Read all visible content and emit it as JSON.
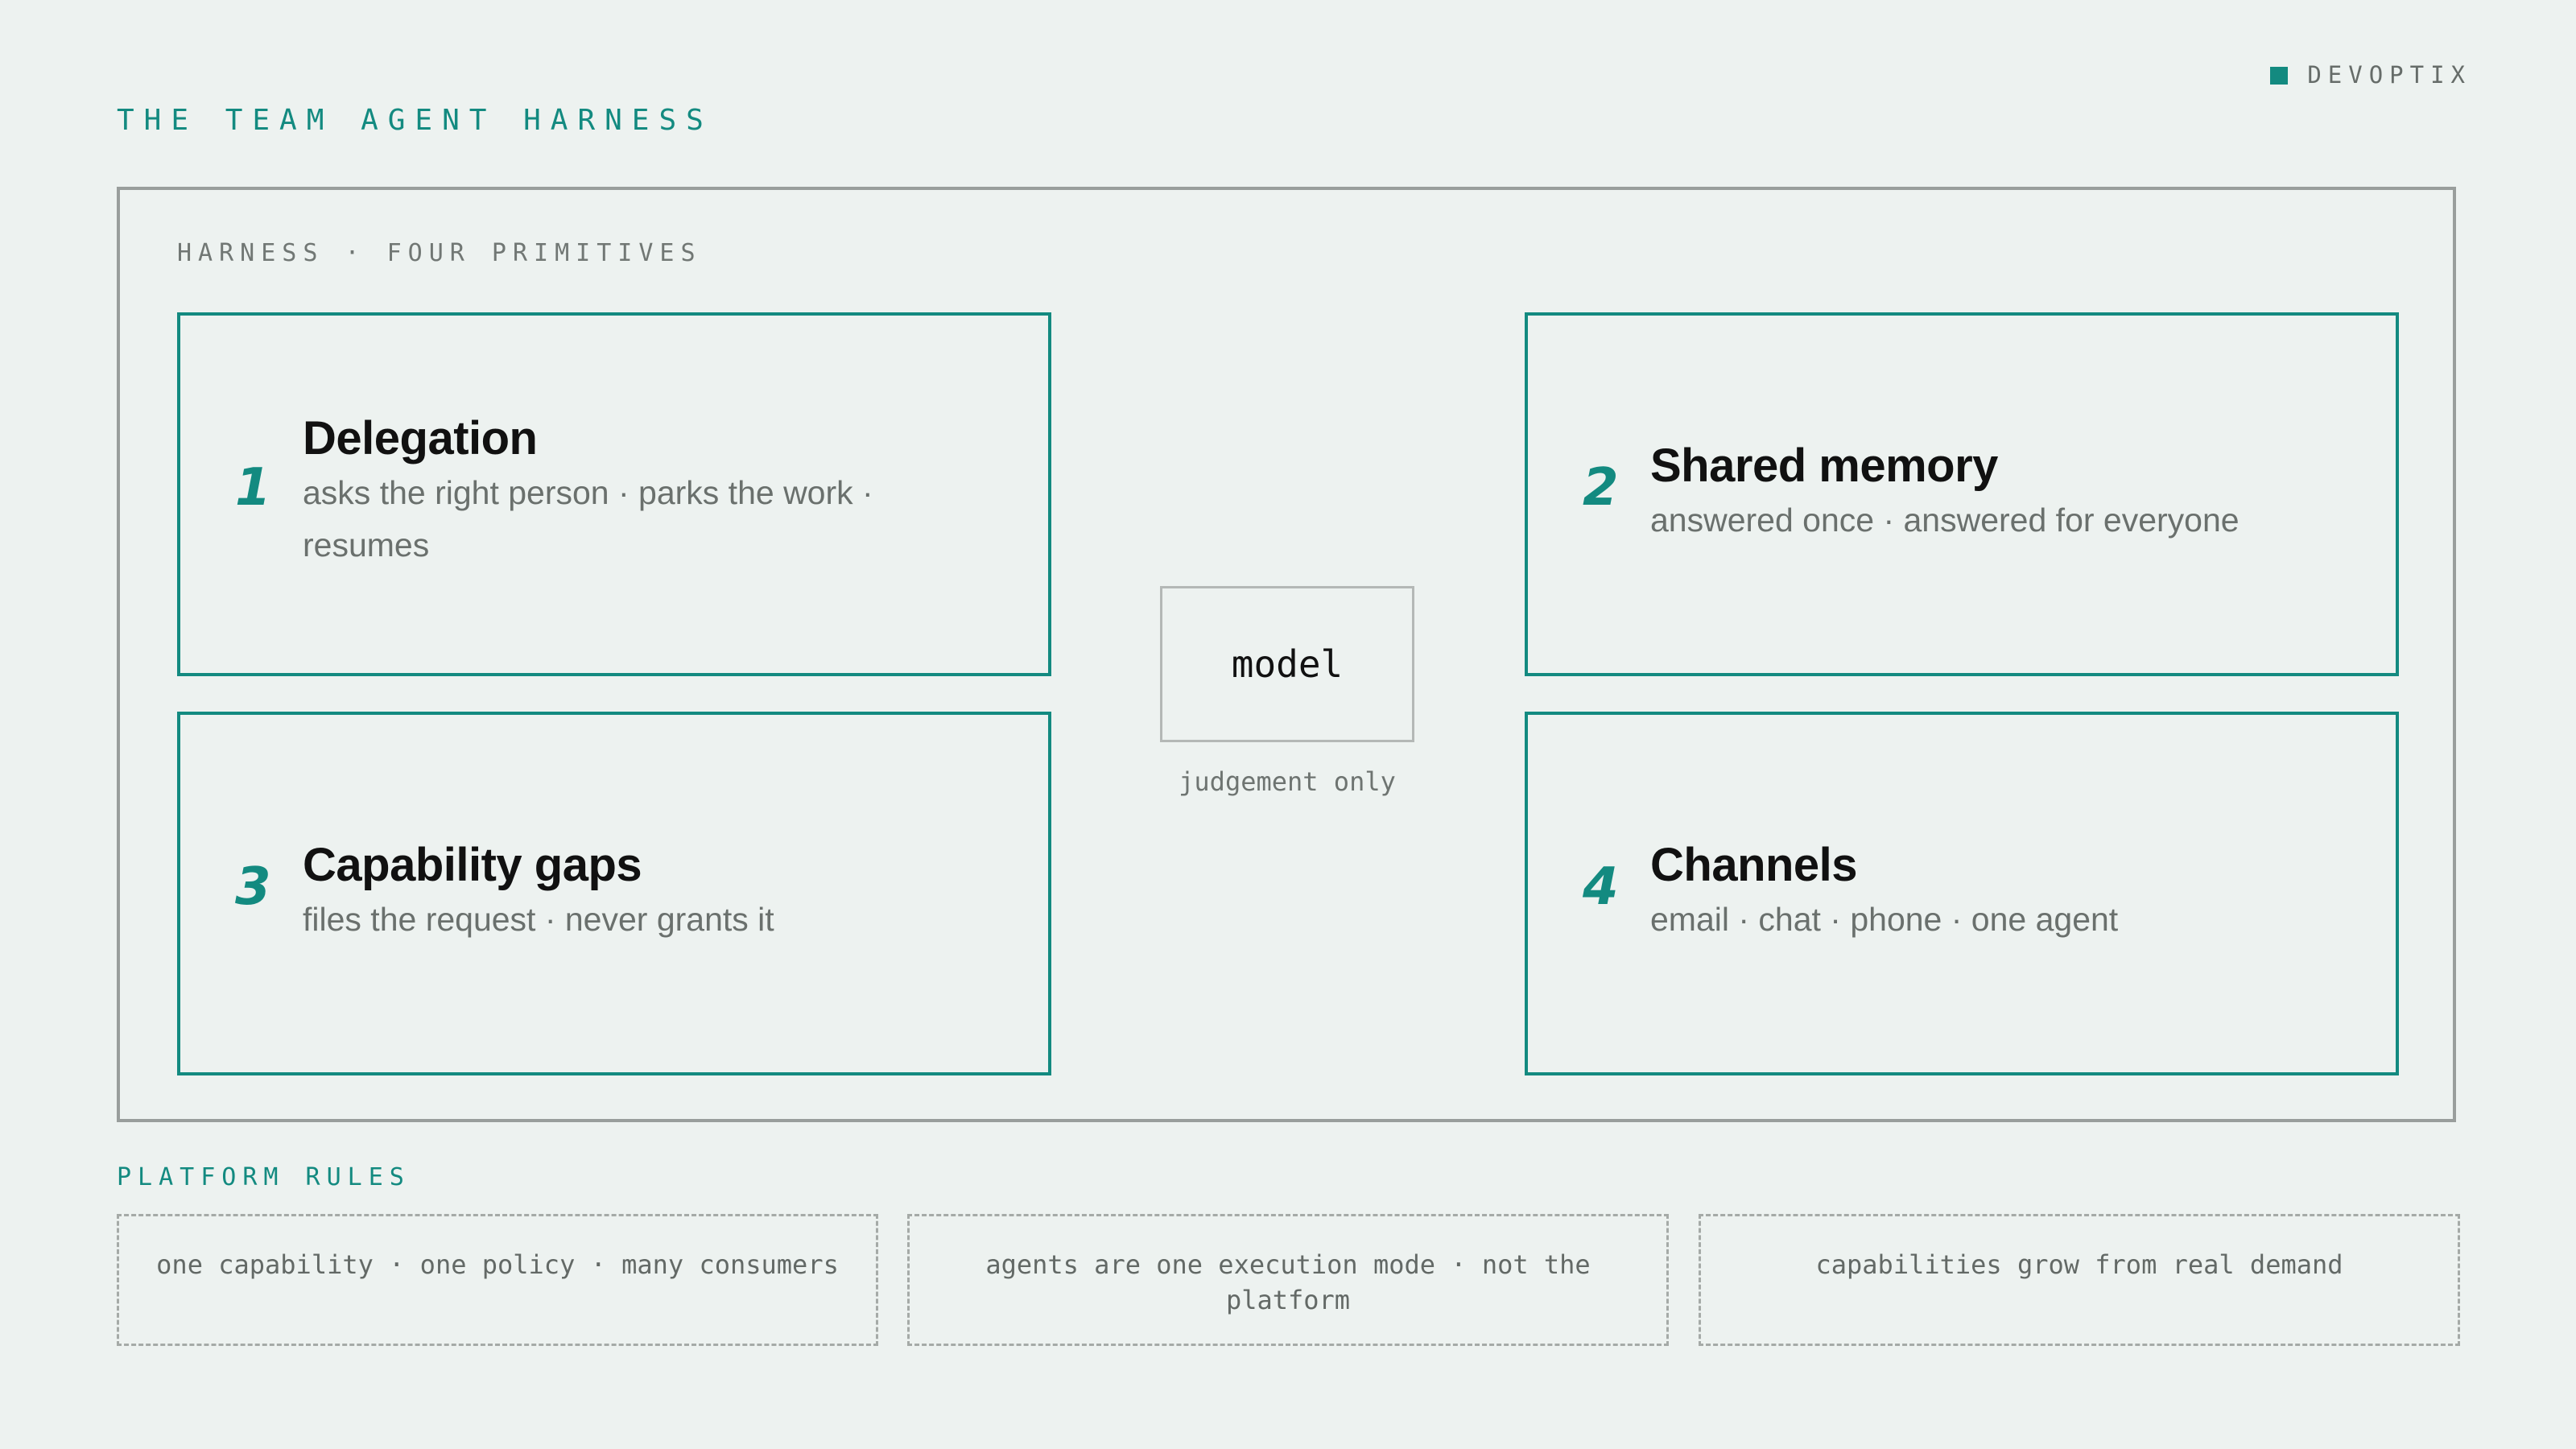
{
  "brand": {
    "name": "DEVOPTIX",
    "accent_color": "#138a80"
  },
  "title": "THE TEAM AGENT HARNESS",
  "harness": {
    "label": "HARNESS · FOUR PRIMITIVES",
    "primitives": [
      {
        "number": "1",
        "title": "Delegation",
        "description": "asks the right person · parks the work · resumes"
      },
      {
        "number": "2",
        "title": "Shared memory",
        "description": "answered once · answered for everyone"
      },
      {
        "number": "3",
        "title": "Capability gaps",
        "description": "files the request · never grants it"
      },
      {
        "number": "4",
        "title": "Channels",
        "description": "email · chat · phone · one agent"
      }
    ],
    "model": {
      "label": "model",
      "caption": "judgement only"
    }
  },
  "platform_rules": {
    "title": "PLATFORM RULES",
    "rules": [
      "one capability · one policy · many consumers",
      "agents are one execution mode · not the platform",
      "capabilities grow from real demand"
    ]
  }
}
